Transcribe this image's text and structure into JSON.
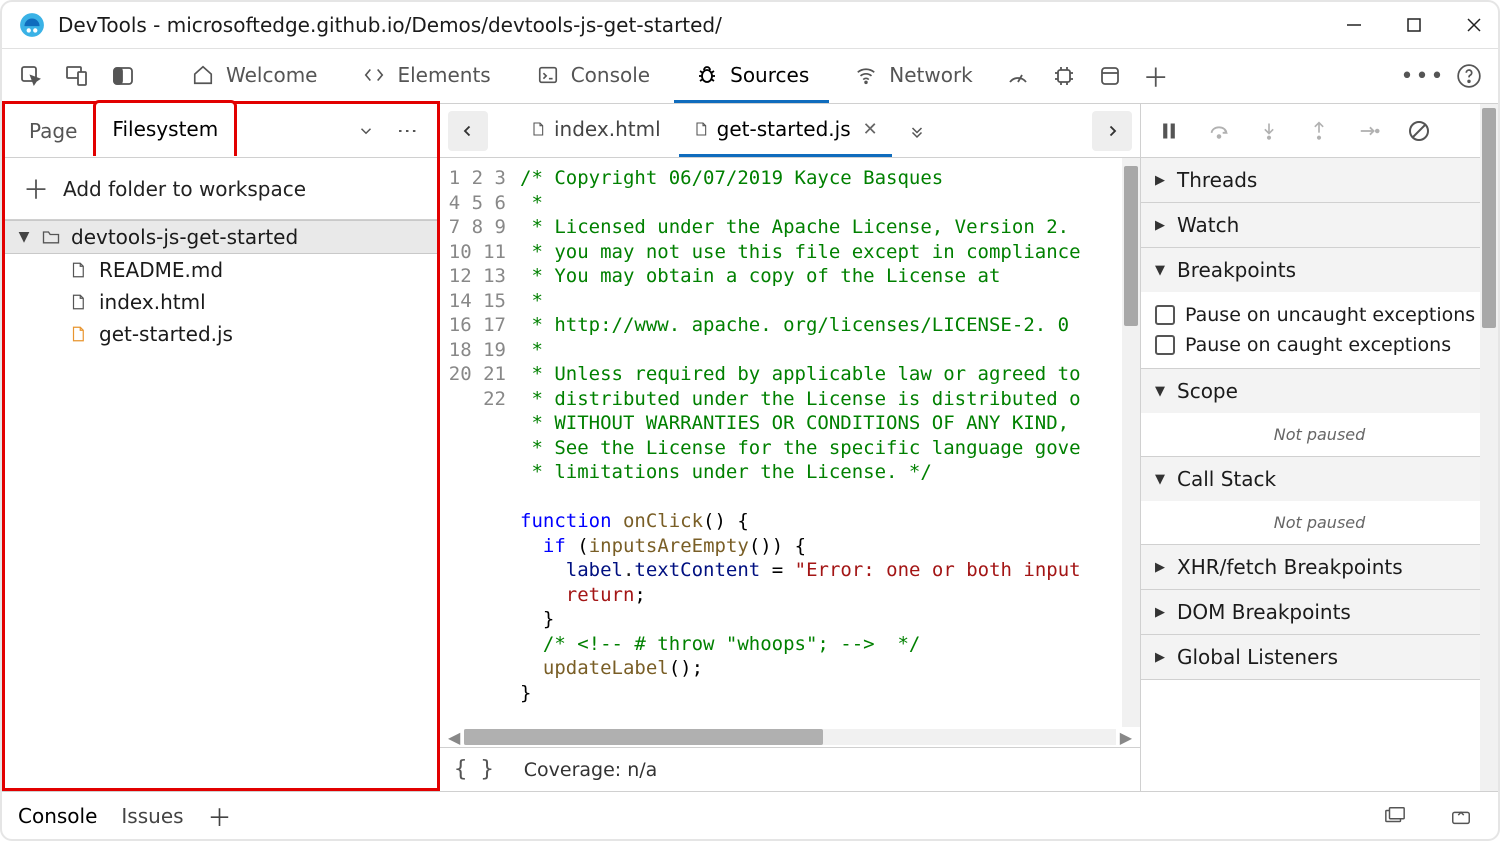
{
  "window": {
    "title": "DevTools - microsoftedge.github.io/Demos/devtools-js-get-started/"
  },
  "topTabs": {
    "welcome": "Welcome",
    "elements": "Elements",
    "console": "Console",
    "sources": "Sources",
    "network": "Network"
  },
  "leftPane": {
    "tabs": {
      "page": "Page",
      "filesystem": "Filesystem"
    },
    "addFolder": "Add folder to workspace",
    "tree": {
      "folder": "devtools-js-get-started",
      "files": [
        "README.md",
        "index.html",
        "get-started.js"
      ]
    }
  },
  "fileTabs": {
    "index": "index.html",
    "getStarted": "get-started.js"
  },
  "code": {
    "lines": [
      "/* Copyright 06/07/2019 Kayce Basques",
      " *",
      " * Licensed under the Apache License, Version 2.",
      " * you may not use this file except in compliance",
      " * You may obtain a copy of the License at",
      " *",
      " * http://www. apache. org/licenses/LICENSE-2. 0",
      " *",
      " * Unless required by applicable law or agreed to",
      " * distributed under the License is distributed o",
      " * WITHOUT WARRANTIES OR CONDITIONS OF ANY KIND,",
      " * See the License for the specific language gove",
      " * limitations under the License. */",
      "",
      "function onClick() {",
      "  if (inputsAreEmpty()) {",
      "    label.textContent = \"Error: one or both input",
      "    return;",
      "  }",
      "  /* <!-- # throw \"whoops\"; -->  */",
      "  updateLabel();",
      "}"
    ]
  },
  "midFooter": {
    "coverage": "Coverage: n/a"
  },
  "debugger": {
    "threads": "Threads",
    "watch": "Watch",
    "breakpoints": "Breakpoints",
    "pauseUncaught": "Pause on uncaught exceptions",
    "pauseCaught": "Pause on caught exceptions",
    "scope": "Scope",
    "notPaused": "Not paused",
    "callStack": "Call Stack",
    "xhr": "XHR/fetch Breakpoints",
    "dom": "DOM Breakpoints",
    "global": "Global Listeners"
  },
  "bottom": {
    "console": "Console",
    "issues": "Issues"
  }
}
